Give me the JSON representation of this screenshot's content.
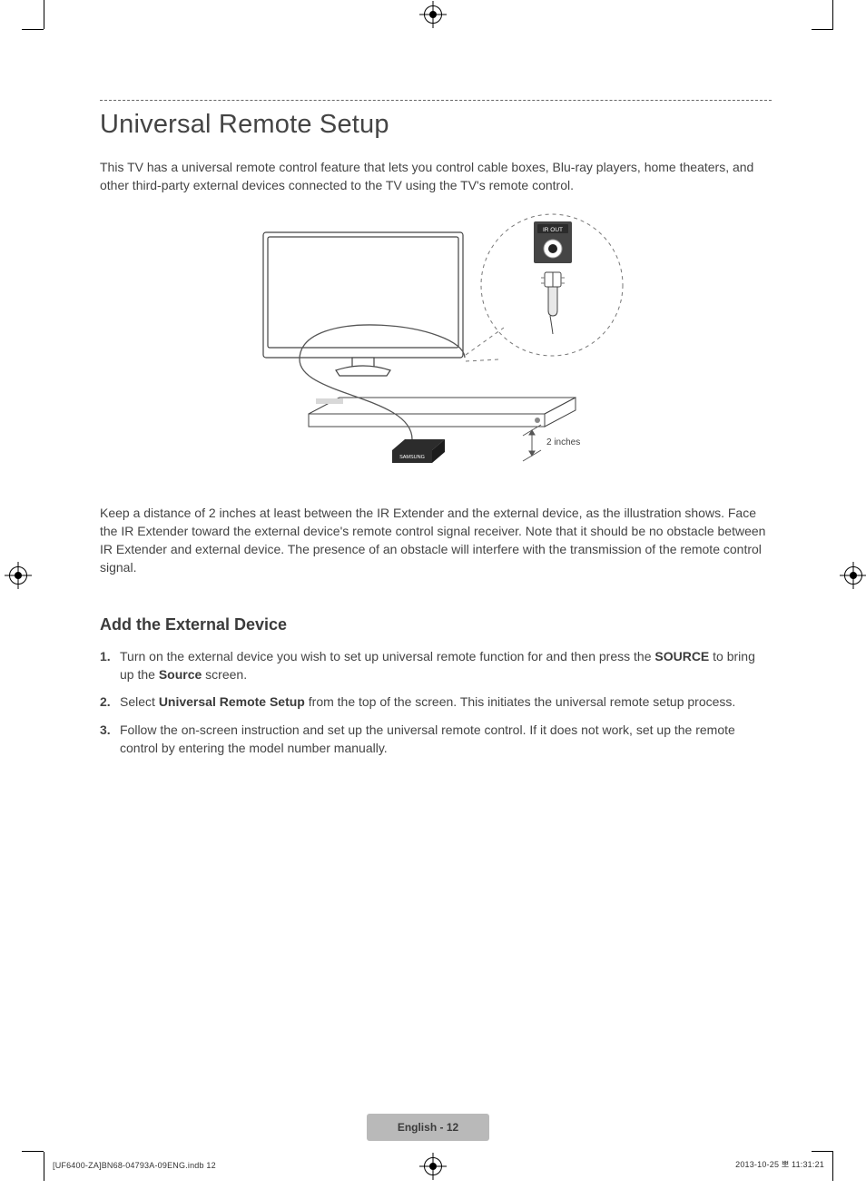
{
  "header": {
    "title": "Universal Remote Setup"
  },
  "intro": "This TV has a universal remote control feature that lets you control cable boxes, Blu-ray players, home theaters, and other third-party external devices connected to the TV using the TV's remote control.",
  "diagram": {
    "ir_out_label": "IR OUT",
    "extender_brand": "SAMSUNG",
    "distance_label": "2 inches"
  },
  "caption": "Keep a distance of 2 inches at least between the IR Extender and the external device, as the illustration shows. Face the IR Extender toward the external device's remote control signal receiver. Note that it should be no obstacle between IR Extender and external device. The presence of an obstacle will interfere with the transmission of the remote control signal.",
  "section": {
    "heading": "Add the External Device",
    "steps": [
      {
        "pre": "Turn on the external device you wish to set up universal remote function for and then press the ",
        "bold1": "SOURCE",
        "mid": " to bring up the ",
        "bold2": "Source",
        "post": " screen."
      },
      {
        "pre": "Select ",
        "bold1": "Universal Remote Setup",
        "post": " from the top of the screen. This initiates the universal remote setup process."
      },
      {
        "pre": "Follow the on-screen instruction and set up the universal remote control. If it does not work, set up the remote control by entering the model number manually."
      }
    ]
  },
  "footer": {
    "page_label": "English - 12",
    "left": "[UF6400-ZA]BN68-04793A-09ENG.indb   12",
    "right": "2013-10-25   뽀 11:31:21"
  }
}
